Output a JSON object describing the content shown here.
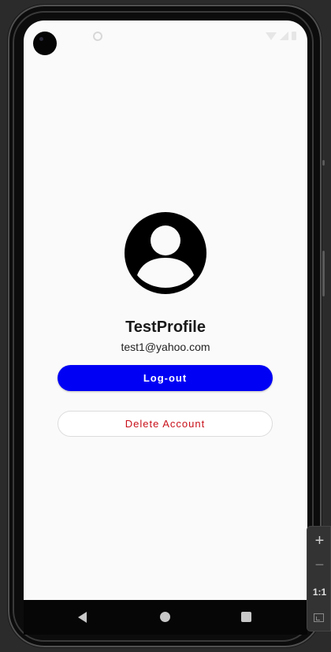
{
  "profile": {
    "name": "TestProfile",
    "email": "test1@yahoo.com"
  },
  "actions": {
    "logout_label": "Log-out",
    "delete_label": "Delete Account"
  },
  "emulator_zoom": {
    "zoom_in": "+",
    "zoom_out": "−",
    "actual_size": "1:1"
  },
  "colors": {
    "logout_bg": "#0000f5",
    "delete_text": "#c8101a",
    "screen_bg": "#fafafa"
  },
  "icons": {
    "avatar": "account-circle-icon",
    "nav_back": "nav-back-icon",
    "nav_home": "nav-home-icon",
    "nav_recents": "nav-recents-icon"
  }
}
